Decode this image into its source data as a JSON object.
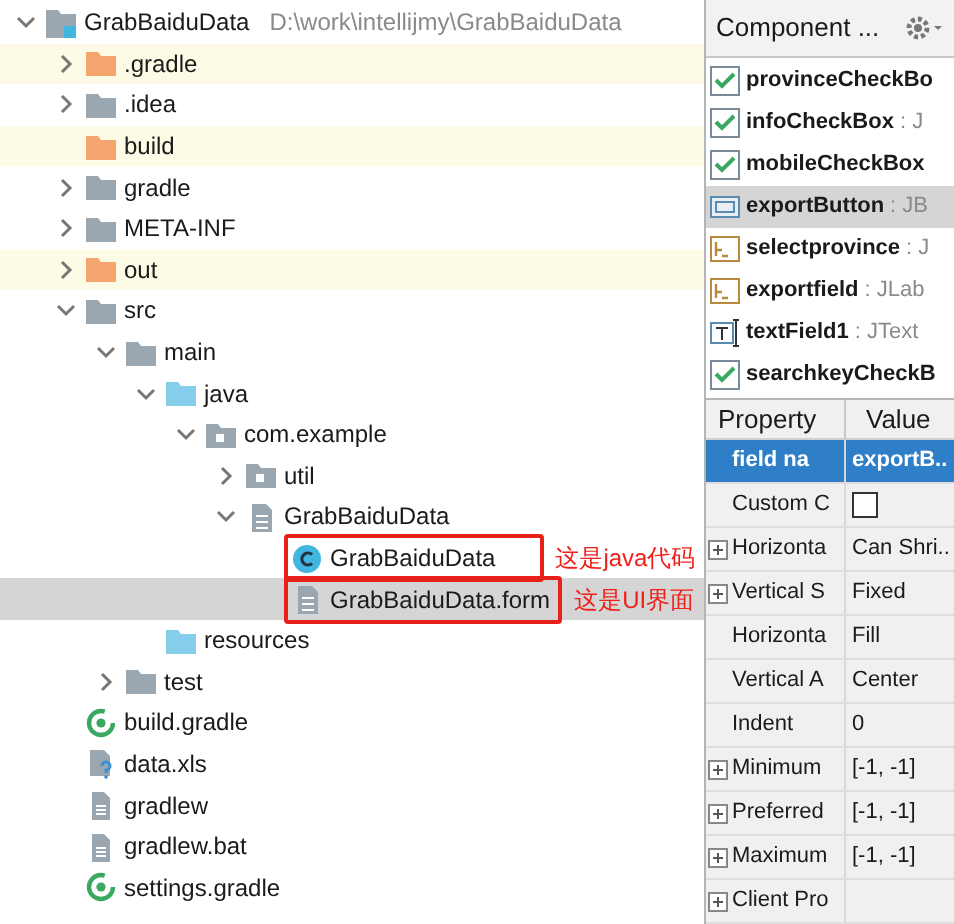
{
  "project_tree": {
    "name": "GrabBaiduData",
    "kind": "module",
    "path": "D:\\work\\intellijmy\\GrabBaiduData",
    "expanded": true,
    "selected": false,
    "children": [
      {
        "name": ".gradle",
        "kind": "excluded-folder",
        "expanded": false,
        "selected": false
      },
      {
        "name": ".idea",
        "kind": "folder",
        "expanded": false,
        "selected": false
      },
      {
        "name": "build",
        "kind": "excluded-folder",
        "selected": false
      },
      {
        "name": "gradle",
        "kind": "folder",
        "expanded": false,
        "selected": false
      },
      {
        "name": "META-INF",
        "kind": "folder",
        "expanded": false,
        "selected": false
      },
      {
        "name": "out",
        "kind": "excluded-folder",
        "expanded": false,
        "selected": false
      },
      {
        "name": "src",
        "kind": "folder",
        "expanded": true,
        "selected": false,
        "children": [
          {
            "name": "main",
            "kind": "folder",
            "expanded": true,
            "selected": false,
            "children": [
              {
                "name": "java",
                "kind": "source-folder",
                "expanded": true,
                "selected": false,
                "children": [
                  {
                    "name": "com.example",
                    "kind": "package",
                    "expanded": true,
                    "selected": false,
                    "children": [
                      {
                        "name": "util",
                        "kind": "package",
                        "expanded": false,
                        "selected": false
                      },
                      {
                        "name": "GrabBaiduData",
                        "kind": "form",
                        "expanded": true,
                        "selected": false,
                        "children": [
                          {
                            "name": "GrabBaiduData",
                            "kind": "class",
                            "selected": false,
                            "annotation": "这是java代码"
                          },
                          {
                            "name": "GrabBaiduData.form",
                            "kind": "form",
                            "selected": true,
                            "annotation": "这是UI界面"
                          }
                        ]
                      }
                    ]
                  }
                ]
              },
              {
                "name": "resources",
                "kind": "source-folder",
                "selected": false
              }
            ]
          },
          {
            "name": "test",
            "kind": "folder",
            "expanded": false,
            "selected": false
          }
        ]
      },
      {
        "name": "build.gradle",
        "kind": "gradle",
        "selected": false
      },
      {
        "name": "data.xls",
        "kind": "unknown-file",
        "selected": false
      },
      {
        "name": "gradlew",
        "kind": "text-file",
        "selected": false
      },
      {
        "name": "gradlew.bat",
        "kind": "text-file",
        "selected": false
      },
      {
        "name": "settings.gradle",
        "kind": "gradle",
        "selected": false
      }
    ]
  },
  "component_tree": {
    "title": "Component ...",
    "items": [
      {
        "name": "provinceCheckBo",
        "kind": "checkbox",
        "selected": false
      },
      {
        "name": "infoCheckBox",
        "type": ": J",
        "kind": "checkbox",
        "selected": false
      },
      {
        "name": "mobileCheckBox",
        "kind": "checkbox",
        "selected": false
      },
      {
        "name": "exportButton",
        "type": ": JB",
        "kind": "button",
        "selected": true
      },
      {
        "name": "selectprovince",
        "type": ": J",
        "kind": "label",
        "selected": false
      },
      {
        "name": "exportfield",
        "type": ": JLab",
        "kind": "label",
        "selected": false
      },
      {
        "name": "textField1",
        "type": ": JText",
        "kind": "textfield",
        "selected": false
      },
      {
        "name": "searchkeyCheckB",
        "kind": "checkbox",
        "selected": false
      }
    ]
  },
  "properties": {
    "columns": [
      "Property",
      "Value"
    ],
    "rows": [
      {
        "name": "field na",
        "value": "exportB..",
        "selected": true,
        "expandable": false
      },
      {
        "name": "Custom C",
        "kind": "checkbox",
        "checked": false,
        "selected": false,
        "expandable": false
      },
      {
        "name": "Horizonta",
        "value": "Can Shri..",
        "selected": false,
        "expandable": true
      },
      {
        "name": "Vertical S",
        "value": "Fixed",
        "selected": false,
        "expandable": true
      },
      {
        "name": "Horizonta",
        "value": "Fill",
        "selected": false,
        "expandable": false
      },
      {
        "name": "Vertical A",
        "value": "Center",
        "selected": false,
        "expandable": false
      },
      {
        "name": "Indent",
        "value": "0",
        "selected": false,
        "expandable": false
      },
      {
        "name": "Minimum",
        "value": "[-1, -1]",
        "selected": false,
        "expandable": true
      },
      {
        "name": "Preferred",
        "value": "[-1, -1]",
        "selected": false,
        "expandable": true
      },
      {
        "name": "Maximum",
        "value": "[-1, -1]",
        "selected": false,
        "expandable": true
      },
      {
        "name": "Client Pro",
        "selected": false,
        "expandable": true
      }
    ]
  }
}
